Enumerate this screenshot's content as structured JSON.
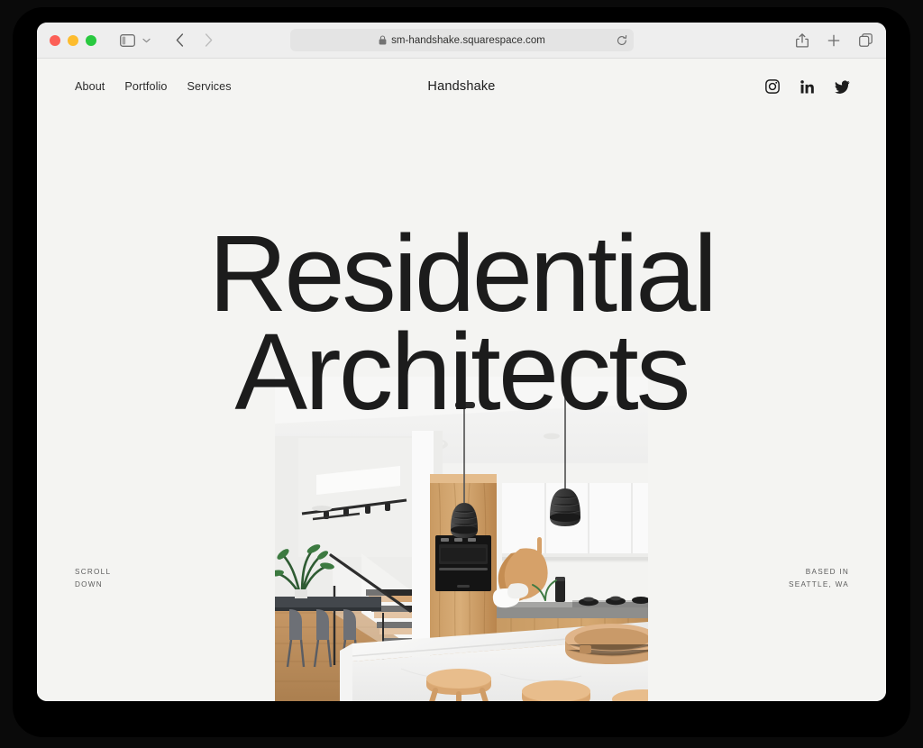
{
  "browser": {
    "traffic_lights": [
      "close",
      "minimize",
      "fullscreen"
    ],
    "url": "sm-handshake.squarespace.com",
    "lock_icon": "lock-icon",
    "reload_icon": "reload-icon",
    "sidebar_icon": "sidebar-icon",
    "sidebar_chevron_icon": "chevron-down-icon",
    "back_icon": "chevron-left-icon",
    "forward_icon": "chevron-right-icon",
    "share_icon": "share-icon",
    "new_tab_icon": "plus-icon",
    "tabs_icon": "tab-overview-icon"
  },
  "site": {
    "title": "Handshake",
    "nav": [
      {
        "label": "About"
      },
      {
        "label": "Portfolio"
      },
      {
        "label": "Services"
      }
    ],
    "social": [
      {
        "name": "instagram",
        "label": "Instagram"
      },
      {
        "name": "linkedin",
        "label": "LinkedIn"
      },
      {
        "name": "twitter",
        "label": "Twitter"
      }
    ],
    "hero": {
      "line1": "Residential",
      "line2": "Architects",
      "image_alt": "Modern kitchen interior with white waterfall island, oak cabinetry, two black pendant lamps and wooden stools"
    },
    "captions": {
      "scroll_line1": "SCROLL",
      "scroll_line2": "DOWN",
      "location_line1": "BASED IN",
      "location_line2": "SEATTLE, WA"
    }
  },
  "colors": {
    "page_background": "#f4f4f2",
    "headline": "#1c1c1c",
    "toolbar": "#eeeeee",
    "address_field": "#e4e4e4",
    "caption_text": "#5d5d5d"
  }
}
